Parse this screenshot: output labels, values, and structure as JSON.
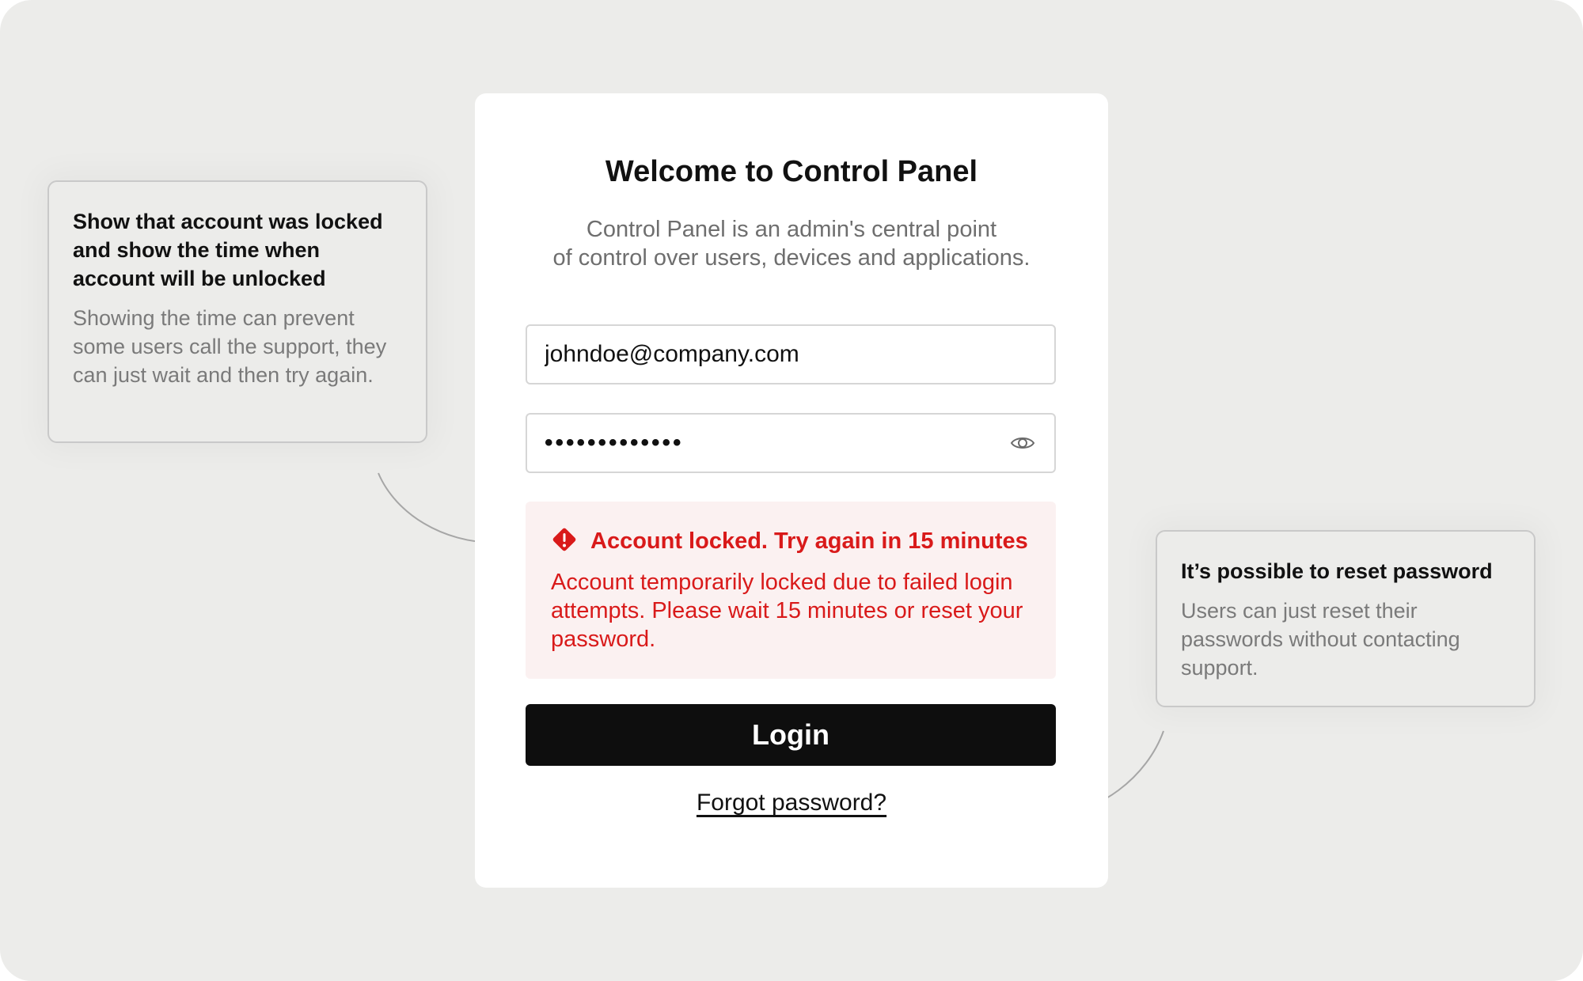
{
  "login": {
    "title": "Welcome to Control Panel",
    "subtitle_line1": "Control Panel is an admin's central point",
    "subtitle_line2": "of control over users, devices and applications.",
    "email_value": "johndoe@company.com",
    "password_value": "•••••••••••••",
    "password_toggle_icon": "eye-icon",
    "login_label": "Login",
    "forgot_label": "Forgot password?"
  },
  "alert": {
    "icon": "warning-diamond-icon",
    "title": "Account locked. Try again in 15 minutes",
    "body": "Account temporarily locked due to failed login attempts. Please wait 15 minutes or reset your password.",
    "color": "#d91a1a",
    "background": "#fbf1f1"
  },
  "annotations": {
    "locked": {
      "title": "Show that account was locked and show the time when account will be unlocked",
      "body": "Showing the time can prevent some users call the support, they can just wait and then try again."
    },
    "reset": {
      "title": "It’s possible to reset password",
      "body": "Users can just reset their passwords without contacting support."
    }
  },
  "colors": {
    "canvas": "#ececea",
    "card": "#ffffff",
    "button": "#0e0e0e",
    "error": "#d91a1a"
  }
}
